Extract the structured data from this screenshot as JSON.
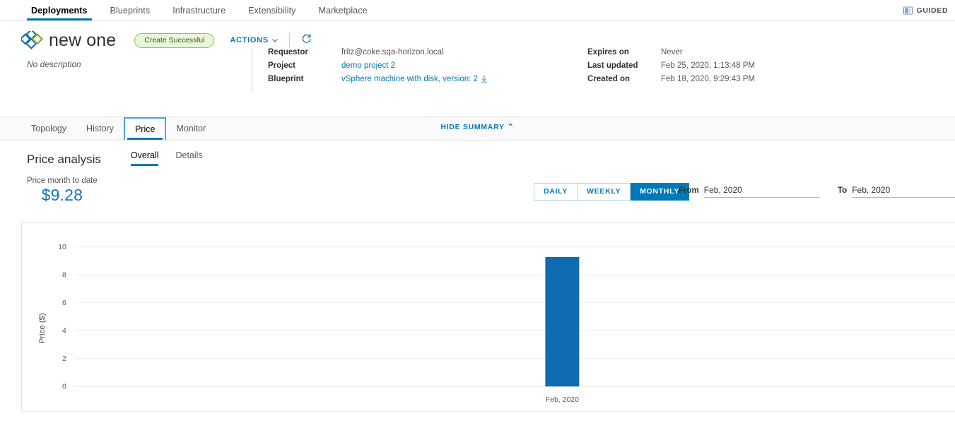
{
  "topnav": {
    "items": [
      {
        "label": "Deployments",
        "active": true
      },
      {
        "label": "Blueprints",
        "active": false
      },
      {
        "label": "Infrastructure",
        "active": false
      },
      {
        "label": "Extensibility",
        "active": false
      },
      {
        "label": "Marketplace",
        "active": false
      }
    ],
    "guided_label": "GUIDED",
    "guided_icon": "book-icon"
  },
  "header": {
    "logo_icon": "diamond-logo",
    "title": "new one",
    "status": "Create Successful",
    "actions_label": "ACTIONS",
    "actions_caret": "⌄",
    "refresh_icon": "refresh-icon",
    "description": "No description",
    "meta_left": [
      {
        "key": "Requestor",
        "value": "fritz@coke.sqa-horizon.local",
        "link": false
      },
      {
        "key": "Project",
        "value": "demo project 2",
        "link": true
      },
      {
        "key": "Blueprint",
        "value": "vSphere machine with disk, version: 2",
        "link": true,
        "icon": "download-icon"
      }
    ],
    "meta_right": [
      {
        "key": "Expires on",
        "value": "Never"
      },
      {
        "key": "Last updated",
        "value": "Feb 25, 2020, 1:13:48 PM"
      },
      {
        "key": "Created on",
        "value": "Feb 18, 2020, 9:29:43 PM"
      }
    ],
    "hide_summary": "HIDE SUMMARY",
    "hide_summary_chevron": "⌃"
  },
  "subtabs": [
    {
      "label": "Topology",
      "active": false
    },
    {
      "label": "History",
      "active": false
    },
    {
      "label": "Price",
      "active": true
    },
    {
      "label": "Monitor",
      "active": false
    }
  ],
  "price_analysis": {
    "title": "Price analysis",
    "tabs": [
      {
        "label": "Overall",
        "active": true
      },
      {
        "label": "Details",
        "active": false
      }
    ],
    "month_to_date_label": "Price month to date",
    "month_to_date_value": "$9.28",
    "granularity": [
      {
        "label": "DAILY",
        "active": false
      },
      {
        "label": "WEEKLY",
        "active": false
      },
      {
        "label": "MONTHLY",
        "active": true
      }
    ],
    "from_label": "From",
    "from_value": "Feb, 2020",
    "from_placeholder": "Feb, 2020",
    "to_label": "To",
    "to_value": "Feb, 2020",
    "to_placeholder": "Feb, 2020"
  },
  "colors": {
    "accent": "#0079b8",
    "bar": "#0f6cb0",
    "value_blue": "#1273c4",
    "status_green_border": "#8cc653",
    "status_green_bg": "#e9f5d9"
  },
  "chart_data": {
    "type": "bar",
    "title": "",
    "categories": [
      "Feb, 2020"
    ],
    "values": [
      9.28
    ],
    "series": [
      {
        "name": "Price",
        "values": [
          9.28
        ]
      }
    ],
    "xlabel": "",
    "ylabel": "Price ($)",
    "ylim": [
      0,
      11
    ],
    "yticks": [
      0,
      2,
      4,
      6,
      8,
      10
    ],
    "ytick_labels": [
      "0",
      "2",
      "4",
      "6",
      "8",
      "10"
    ],
    "grid": true,
    "legend": false,
    "bar_color": "#0f6cb0"
  }
}
